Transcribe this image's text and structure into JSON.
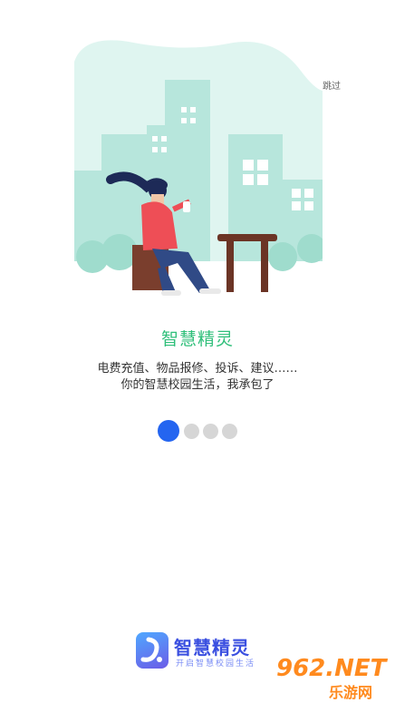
{
  "skip_label": "跳过",
  "title": "智慧精灵",
  "description_line1": "电费充值、物品报修、投诉、建议……",
  "description_line2": "你的智慧校园生活，我承包了",
  "pagination": {
    "current_page": 1,
    "total_pages": 4
  },
  "logo": {
    "name": "智慧精灵",
    "slogan": "开启智慧校园生活"
  },
  "watermark": {
    "number": "962.NET",
    "text": "乐游网"
  },
  "colors": {
    "accent": "#2465f0",
    "title_green": "#2fbf7a",
    "bg_mint": "#dff5f0",
    "building": "#b7e6dc"
  },
  "icons": {
    "illustration": "woman-reading-phone-illustration"
  }
}
